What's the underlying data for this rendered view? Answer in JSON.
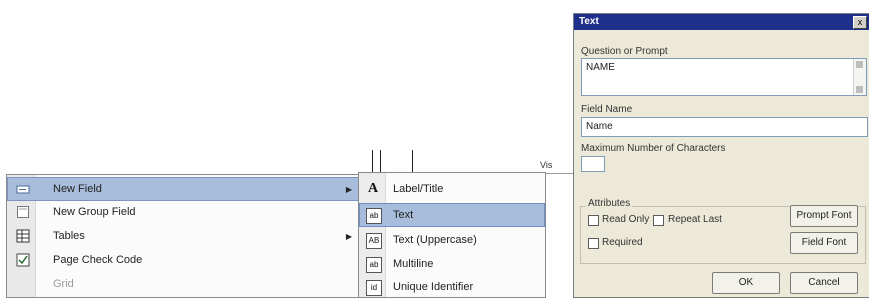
{
  "context_menu": {
    "items": [
      {
        "label": "New Field",
        "has_submenu": true,
        "icon": "new-field-icon",
        "highlighted": true
      },
      {
        "label": "New Group Field",
        "has_submenu": false,
        "icon": "group-field-icon"
      },
      {
        "label": "Tables",
        "has_submenu": true,
        "icon": "tables-icon"
      },
      {
        "label": "Page Check Code",
        "has_submenu": false,
        "icon": "check-code-icon"
      },
      {
        "label": "Grid",
        "has_submenu": false,
        "icon": "",
        "dimmed": true
      }
    ]
  },
  "submenu": {
    "items": [
      {
        "label": "Label/Title",
        "icon_glyph": "A",
        "icon": "label-title-icon"
      },
      {
        "label": "Text",
        "icon_glyph": "ab",
        "icon": "text-field-icon",
        "highlighted": true
      },
      {
        "label": "Text (Uppercase)",
        "icon_glyph": "AB",
        "icon": "text-uppercase-icon"
      },
      {
        "label": "Multiline",
        "icon_glyph": "ab",
        "icon": "multiline-icon"
      },
      {
        "label": "Unique Identifier",
        "icon_glyph": "id",
        "icon": "unique-identifier-icon"
      }
    ]
  },
  "grid": {
    "cell_text": "Vis"
  },
  "dialog": {
    "title": "Text",
    "close_label": "x",
    "question_label": "Question or Prompt",
    "question_value": "NAME",
    "field_name_label": "Field Name",
    "field_name_value": "Name",
    "max_chars_label": "Maximum Number of Characters",
    "max_chars_value": "",
    "attributes_label": "Attributes",
    "read_only_label": "Read Only",
    "repeat_last_label": "Repeat Last",
    "required_label": "Required",
    "prompt_font_label": "Prompt Font",
    "field_font_label": "Field Font",
    "ok_label": "OK",
    "cancel_label": "Cancel"
  },
  "colors": {
    "highlight": "#a8bddc",
    "title_bar": "#1f2f8c",
    "dialog_bg": "#ece9d8"
  }
}
